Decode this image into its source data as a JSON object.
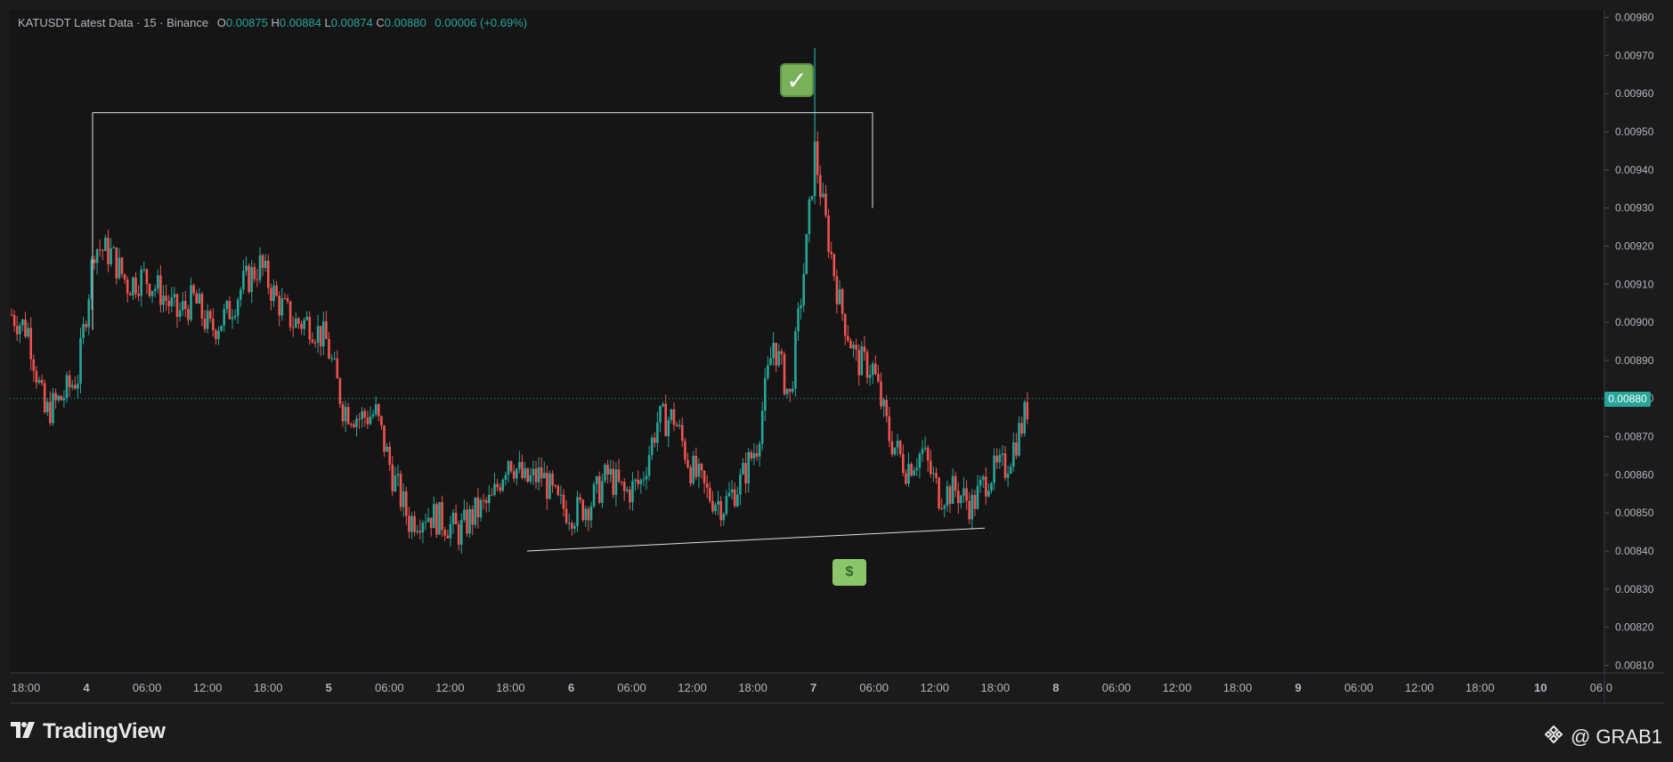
{
  "header": {
    "symbol_line": "KATUSDT Latest Data · 15 · Binance",
    "open_label": "O",
    "open": "0.00875",
    "high_label": "H",
    "high": "0.00884",
    "low_label": "L",
    "low": "0.00874",
    "close_label": "C",
    "close": "0.00880",
    "change": "0.00006 (+0.69%)"
  },
  "last_price_label": "0.00880",
  "brand": {
    "name": "TradingView"
  },
  "author": {
    "handle": "@ GRAB1"
  },
  "icons": {
    "check": "check-mark-icon",
    "money": "money-bill-icon",
    "brand_logo": "tradingview-logo-icon",
    "binance": "binance-logo-icon"
  },
  "colors": {
    "background": "#1b1b1b",
    "up": "#26a69a",
    "down": "#ef5350",
    "annotation_line": "#e0e0e0",
    "last_price": "#26a69a"
  },
  "chart_data": {
    "type": "candlestick",
    "title": "KATUSDT Latest Data · 15 · Binance",
    "interval": "15",
    "y_axis": {
      "range": [
        0.00808,
        0.00982
      ],
      "ticks": [
        "0.00980",
        "0.00970",
        "0.00960",
        "0.00950",
        "0.00940",
        "0.00930",
        "0.00920",
        "0.00910",
        "0.00900",
        "0.00890",
        "0.00880",
        "0.00870",
        "0.00860",
        "0.00850",
        "0.00840",
        "0.00830",
        "0.00820",
        "0.00810"
      ]
    },
    "x_axis": {
      "ticks": [
        "18:00",
        "4",
        "06:00",
        "12:00",
        "18:00",
        "5",
        "06:00",
        "12:00",
        "18:00",
        "6",
        "06:00",
        "12:00",
        "18:00",
        "7",
        "06:00",
        "12:00",
        "18:00",
        "8",
        "06:00",
        "12:00",
        "18:00",
        "9",
        "06:00",
        "12:00",
        "18:00",
        "10",
        "06:0"
      ],
      "bold_ticks": [
        "4",
        "5",
        "6",
        "7",
        "8",
        "9",
        "10"
      ]
    },
    "last_price": 0.0088,
    "series_close_path": [
      [
        0,
        0.00902
      ],
      [
        2,
        0.00898
      ],
      [
        4,
        0.00876
      ],
      [
        6,
        0.0088
      ],
      [
        8,
        0.00886
      ],
      [
        10,
        0.0092
      ],
      [
        12,
        0.00918
      ],
      [
        14,
        0.0091
      ],
      [
        16,
        0.00912
      ],
      [
        18,
        0.00908
      ],
      [
        20,
        0.00902
      ],
      [
        22,
        0.00906
      ],
      [
        24,
        0.00898
      ],
      [
        26,
        0.00902
      ],
      [
        28,
        0.0091
      ],
      [
        30,
        0.00915
      ],
      [
        32,
        0.00906
      ],
      [
        34,
        0.009
      ],
      [
        36,
        0.009
      ],
      [
        38,
        0.00895
      ],
      [
        40,
        0.00878
      ],
      [
        42,
        0.00875
      ],
      [
        44,
        0.00876
      ],
      [
        46,
        0.0086
      ],
      [
        48,
        0.00848
      ],
      [
        50,
        0.0085
      ],
      [
        52,
        0.00848
      ],
      [
        54,
        0.00845
      ],
      [
        56,
        0.0085
      ],
      [
        58,
        0.00853
      ],
      [
        60,
        0.00865
      ],
      [
        62,
        0.00858
      ],
      [
        64,
        0.0086
      ],
      [
        66,
        0.00852
      ],
      [
        68,
        0.0085
      ],
      [
        70,
        0.00853
      ],
      [
        72,
        0.0086
      ],
      [
        74,
        0.00855
      ],
      [
        76,
        0.00858
      ],
      [
        78,
        0.00874
      ],
      [
        80,
        0.00875
      ],
      [
        82,
        0.00862
      ],
      [
        84,
        0.00855
      ],
      [
        86,
        0.00852
      ],
      [
        88,
        0.00858
      ],
      [
        90,
        0.00868
      ],
      [
        92,
        0.00895
      ],
      [
        94,
        0.0088
      ],
      [
        96,
        0.0092
      ],
      [
        97,
        0.00945
      ],
      [
        98,
        0.0093
      ],
      [
        100,
        0.00905
      ],
      [
        102,
        0.0089
      ],
      [
        104,
        0.00888
      ],
      [
        106,
        0.0087
      ],
      [
        108,
        0.00862
      ],
      [
        110,
        0.00866
      ],
      [
        112,
        0.00855
      ],
      [
        114,
        0.00856
      ],
      [
        116,
        0.00852
      ],
      [
        118,
        0.0086
      ],
      [
        120,
        0.00862
      ],
      [
        122,
        0.00873
      ],
      [
        123,
        0.0088
      ]
    ],
    "annotations": [
      {
        "type": "horizontal_line",
        "label": "resistance",
        "price": 0.00955,
        "from_time": "4 00:00",
        "to_time": "7 06:00"
      },
      {
        "type": "trendline",
        "label": "rising support",
        "from": [
          "5 19:00",
          0.0084
        ],
        "to": [
          "7 17:00",
          0.00846
        ]
      }
    ],
    "notable_points": {
      "spike_high": 0.00972,
      "spike_time": "7 06:00",
      "low": 0.0084
    }
  }
}
